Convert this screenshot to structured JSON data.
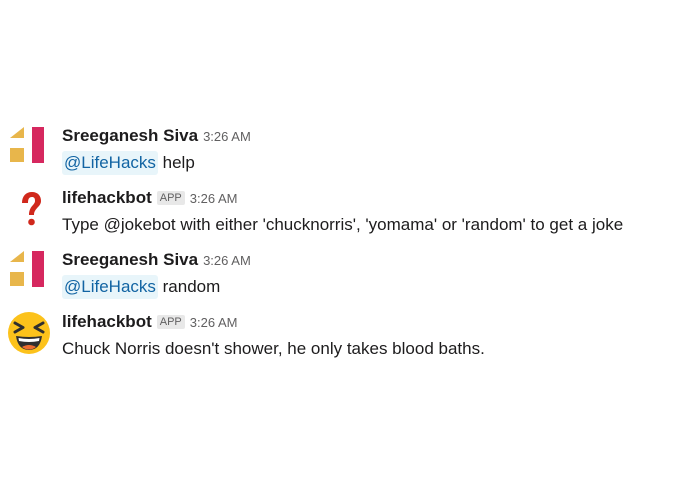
{
  "colors": {
    "avatar_gold": "#e8b64b",
    "avatar_red": "#d6285f",
    "question_mark": "#d0281c",
    "emoji_face": "#fcc21b",
    "mention_text": "#1264a3",
    "mention_bg": "#e8f5fa"
  },
  "messages": [
    {
      "avatar_icon": "sreeganesh-avatar-icon",
      "sender": "Sreeganesh Siva",
      "time": "3:26 AM",
      "mention": "@LifeHacks",
      "text": " help"
    },
    {
      "avatar_icon": "question-mark-icon",
      "sender": "lifehackbot",
      "badge": "APP",
      "time": "3:26 AM",
      "text": "Type @jokebot with either 'chucknorris', 'yomama' or 'random' to get a joke"
    },
    {
      "avatar_icon": "sreeganesh-avatar-icon",
      "sender": "Sreeganesh Siva",
      "time": "3:26 AM",
      "mention": "@LifeHacks",
      "text": " random"
    },
    {
      "avatar_icon": "laughing-emoji-icon",
      "sender": "lifehackbot",
      "badge": "APP",
      "time": "3:26 AM",
      "text": "Chuck Norris doesn't shower, he only takes blood baths."
    }
  ]
}
